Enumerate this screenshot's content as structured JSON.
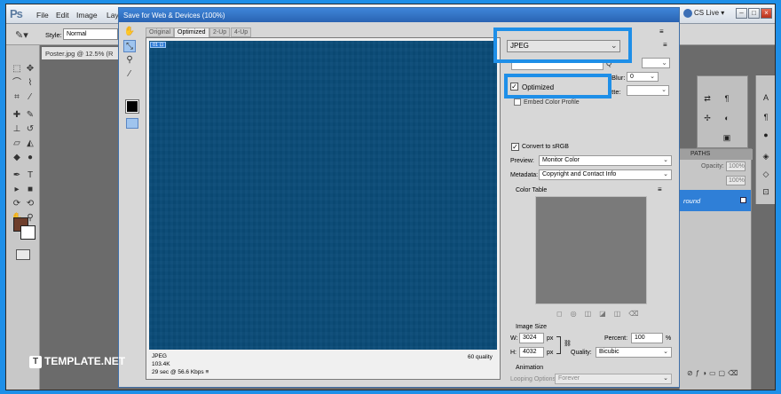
{
  "app": {
    "logo": "Ps",
    "menu": [
      "File",
      "Edit",
      "Image",
      "Lay"
    ],
    "cs_live": "CS Live",
    "options_bar": {
      "style_label": "Style:",
      "style_value": "Normal"
    },
    "document_tab": "Poster.jpg @ 12.5% (R",
    "layers_panel": {
      "tab_paths": "PATHS",
      "opacity_label": "Opacity:",
      "opacity_value": "100%",
      "fill_value": "100%",
      "layer_name": "round"
    }
  },
  "dialog": {
    "title": "Save for Web & Devices (100%)",
    "view_tabs": [
      "Original",
      "Optimized",
      "2-Up",
      "4-Up"
    ],
    "active_view": "Optimized",
    "slice_badge": "01",
    "preview_info": {
      "format": "JPEG",
      "size": "103.4K",
      "time": "29 sec @ 56.6 Kbps",
      "time_menu": "≡",
      "quality": "60 quality"
    },
    "settings": {
      "format": "JPEG",
      "quality_label": "Q",
      "blur_label": "Blur:",
      "blur_value": "0",
      "matte_label": "atte:",
      "optimized_checked": "✓",
      "optimized_label": "Optimized",
      "embed_profile_label": "Embed Color Profile",
      "convert_srgb_checked": "✓",
      "convert_srgb_label": "Convert to sRGB",
      "preview_label": "Preview:",
      "preview_value": "Monitor Color",
      "metadata_label": "Metadata:",
      "metadata_value": "Copyright and Contact Info",
      "color_table_label": "Color Table",
      "image_size_label": "Image Size",
      "width_label": "W:",
      "width_value": "3024",
      "width_unit": "px",
      "height_label": "H:",
      "height_value": "4032",
      "height_unit": "px",
      "percent_label": "Percent:",
      "percent_value": "100",
      "percent_unit": "%",
      "resample_label": "Quality:",
      "resample_value": "Bicubic",
      "animation_label": "Animation",
      "looping_label": "Looping Options:",
      "looping_value": "Forever"
    }
  },
  "icons": {
    "dropdown": "⌄",
    "panel_menu": "≡"
  },
  "watermark": {
    "logo": "T",
    "text": "TEMPLATE.NET"
  },
  "colors": {
    "highlight": "#1e8fe8",
    "canvas": "#0a4b78",
    "title_bar": "#2a63b2"
  }
}
